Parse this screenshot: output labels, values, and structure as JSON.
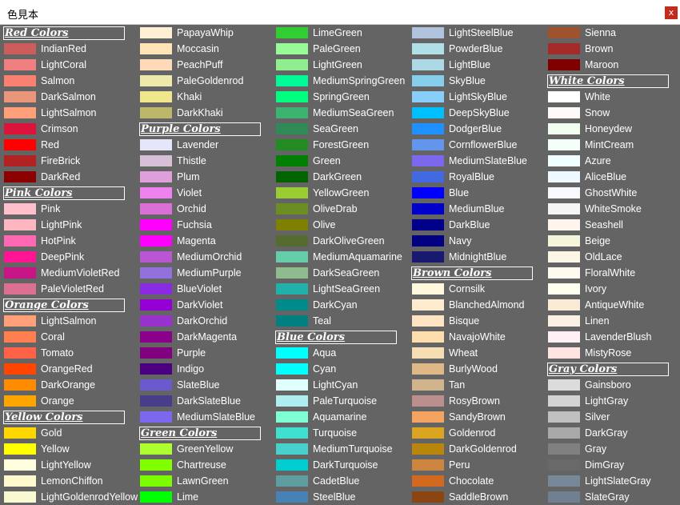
{
  "window": {
    "title": "色見本",
    "close_label": "x"
  },
  "columns": [
    [
      {
        "h": "Red Colors"
      },
      {
        "n": "IndianRed",
        "c": "#CD5C5C"
      },
      {
        "n": "LightCoral",
        "c": "#F08080"
      },
      {
        "n": "Salmon",
        "c": "#FA8072"
      },
      {
        "n": "DarkSalmon",
        "c": "#E9967A"
      },
      {
        "n": "LightSalmon",
        "c": "#FFA07A"
      },
      {
        "n": "Crimson",
        "c": "#DC143C"
      },
      {
        "n": "Red",
        "c": "#FF0000"
      },
      {
        "n": "FireBrick",
        "c": "#B22222"
      },
      {
        "n": "DarkRed",
        "c": "#8B0000"
      },
      {
        "h": "Pink Colors"
      },
      {
        "n": "Pink",
        "c": "#FFC0CB"
      },
      {
        "n": "LightPink",
        "c": "#FFB6C1"
      },
      {
        "n": "HotPink",
        "c": "#FF69B4"
      },
      {
        "n": "DeepPink",
        "c": "#FF1493"
      },
      {
        "n": "MediumVioletRed",
        "c": "#C71585"
      },
      {
        "n": "PaleVioletRed",
        "c": "#DB7093"
      },
      {
        "h": "Orange Colors"
      },
      {
        "n": "LightSalmon",
        "c": "#FFA07A"
      },
      {
        "n": "Coral",
        "c": "#FF7F50"
      },
      {
        "n": "Tomato",
        "c": "#FF6347"
      },
      {
        "n": "OrangeRed",
        "c": "#FF4500"
      },
      {
        "n": "DarkOrange",
        "c": "#FF8C00"
      },
      {
        "n": "Orange",
        "c": "#FFA500"
      },
      {
        "h": "Yellow Colors"
      },
      {
        "n": "Gold",
        "c": "#FFD700"
      },
      {
        "n": "Yellow",
        "c": "#FFFF00"
      },
      {
        "n": "LightYellow",
        "c": "#FFFFE0"
      },
      {
        "n": "LemonChiffon",
        "c": "#FFFACD"
      },
      {
        "n": "LightGoldenrodYellow",
        "c": "#FAFAD2"
      }
    ],
    [
      {
        "n": "PapayaWhip",
        "c": "#FFEFD5"
      },
      {
        "n": "Moccasin",
        "c": "#FFE4B5"
      },
      {
        "n": "PeachPuff",
        "c": "#FFDAB9"
      },
      {
        "n": "PaleGoldenrod",
        "c": "#EEE8AA"
      },
      {
        "n": "Khaki",
        "c": "#F0E68C"
      },
      {
        "n": "DarkKhaki",
        "c": "#BDB76B"
      },
      {
        "h": "Purple Colors"
      },
      {
        "n": "Lavender",
        "c": "#E6E6FA"
      },
      {
        "n": "Thistle",
        "c": "#D8BFD8"
      },
      {
        "n": "Plum",
        "c": "#DDA0DD"
      },
      {
        "n": "Violet",
        "c": "#EE82EE"
      },
      {
        "n": "Orchid",
        "c": "#DA70D6"
      },
      {
        "n": "Fuchsia",
        "c": "#FF00FF"
      },
      {
        "n": "Magenta",
        "c": "#FF00FF"
      },
      {
        "n": "MediumOrchid",
        "c": "#BA55D3"
      },
      {
        "n": "MediumPurple",
        "c": "#9370DB"
      },
      {
        "n": "BlueViolet",
        "c": "#8A2BE2"
      },
      {
        "n": "DarkViolet",
        "c": "#9400D3"
      },
      {
        "n": "DarkOrchid",
        "c": "#9932CC"
      },
      {
        "n": "DarkMagenta",
        "c": "#8B008B"
      },
      {
        "n": "Purple",
        "c": "#800080"
      },
      {
        "n": "Indigo",
        "c": "#4B0082"
      },
      {
        "n": "SlateBlue",
        "c": "#6A5ACD"
      },
      {
        "n": "DarkSlateBlue",
        "c": "#483D8B"
      },
      {
        "n": "MediumSlateBlue",
        "c": "#7B68EE"
      },
      {
        "h": "Green Colors"
      },
      {
        "n": "GreenYellow",
        "c": "#ADFF2F"
      },
      {
        "n": "Chartreuse",
        "c": "#7FFF00"
      },
      {
        "n": "LawnGreen",
        "c": "#7CFC00"
      },
      {
        "n": "Lime",
        "c": "#00FF00"
      }
    ],
    [
      {
        "n": "LimeGreen",
        "c": "#32CD32"
      },
      {
        "n": "PaleGreen",
        "c": "#98FB98"
      },
      {
        "n": "LightGreen",
        "c": "#90EE90"
      },
      {
        "n": "MediumSpringGreen",
        "c": "#00FA9A"
      },
      {
        "n": "SpringGreen",
        "c": "#00FF7F"
      },
      {
        "n": "MediumSeaGreen",
        "c": "#3CB371"
      },
      {
        "n": "SeaGreen",
        "c": "#2E8B57"
      },
      {
        "n": "ForestGreen",
        "c": "#228B22"
      },
      {
        "n": "Green",
        "c": "#008000"
      },
      {
        "n": "DarkGreen",
        "c": "#006400"
      },
      {
        "n": "YellowGreen",
        "c": "#9ACD32"
      },
      {
        "n": "OliveDrab",
        "c": "#6B8E23"
      },
      {
        "n": "Olive",
        "c": "#808000"
      },
      {
        "n": "DarkOliveGreen",
        "c": "#556B2F"
      },
      {
        "n": "MediumAquamarine",
        "c": "#66CDAA"
      },
      {
        "n": "DarkSeaGreen",
        "c": "#8FBC8F"
      },
      {
        "n": "LightSeaGreen",
        "c": "#20B2AA"
      },
      {
        "n": "DarkCyan",
        "c": "#008B8B"
      },
      {
        "n": "Teal",
        "c": "#008080"
      },
      {
        "h": "Blue Colors"
      },
      {
        "n": "Aqua",
        "c": "#00FFFF"
      },
      {
        "n": "Cyan",
        "c": "#00FFFF"
      },
      {
        "n": "LightCyan",
        "c": "#E0FFFF"
      },
      {
        "n": "PaleTurquoise",
        "c": "#AFEEEE"
      },
      {
        "n": "Aquamarine",
        "c": "#7FFFD4"
      },
      {
        "n": "Turquoise",
        "c": "#40E0D0"
      },
      {
        "n": "MediumTurquoise",
        "c": "#48D1CC"
      },
      {
        "n": "DarkTurquoise",
        "c": "#00CED1"
      },
      {
        "n": "CadetBlue",
        "c": "#5F9EA0"
      },
      {
        "n": "SteelBlue",
        "c": "#4682B4"
      }
    ],
    [
      {
        "n": "LightSteelBlue",
        "c": "#B0C4DE"
      },
      {
        "n": "PowderBlue",
        "c": "#B0E0E6"
      },
      {
        "n": "LightBlue",
        "c": "#ADD8E6"
      },
      {
        "n": "SkyBlue",
        "c": "#87CEEB"
      },
      {
        "n": "LightSkyBlue",
        "c": "#87CEFA"
      },
      {
        "n": "DeepSkyBlue",
        "c": "#00BFFF"
      },
      {
        "n": "DodgerBlue",
        "c": "#1E90FF"
      },
      {
        "n": "CornflowerBlue",
        "c": "#6495ED"
      },
      {
        "n": "MediumSlateBlue",
        "c": "#7B68EE"
      },
      {
        "n": "RoyalBlue",
        "c": "#4169E1"
      },
      {
        "n": "Blue",
        "c": "#0000FF"
      },
      {
        "n": "MediumBlue",
        "c": "#0000CD"
      },
      {
        "n": "DarkBlue",
        "c": "#00008B"
      },
      {
        "n": "Navy",
        "c": "#000080"
      },
      {
        "n": "MidnightBlue",
        "c": "#191970"
      },
      {
        "h": "Brown Colors"
      },
      {
        "n": "Cornsilk",
        "c": "#FFF8DC"
      },
      {
        "n": "BlanchedAlmond",
        "c": "#FFEBCD"
      },
      {
        "n": "Bisque",
        "c": "#FFE4C4"
      },
      {
        "n": "NavajoWhite",
        "c": "#FFDEAD"
      },
      {
        "n": "Wheat",
        "c": "#F5DEB3"
      },
      {
        "n": "BurlyWood",
        "c": "#DEB887"
      },
      {
        "n": "Tan",
        "c": "#D2B48C"
      },
      {
        "n": "RosyBrown",
        "c": "#BC8F8F"
      },
      {
        "n": "SandyBrown",
        "c": "#F4A460"
      },
      {
        "n": "Goldenrod",
        "c": "#DAA520"
      },
      {
        "n": "DarkGoldenrod",
        "c": "#B8860B"
      },
      {
        "n": "Peru",
        "c": "#CD853F"
      },
      {
        "n": "Chocolate",
        "c": "#D2691E"
      },
      {
        "n": "SaddleBrown",
        "c": "#8B4513"
      }
    ],
    [
      {
        "n": "Sienna",
        "c": "#A0522D"
      },
      {
        "n": "Brown",
        "c": "#A52A2A"
      },
      {
        "n": "Maroon",
        "c": "#800000"
      },
      {
        "h": "White Colors"
      },
      {
        "n": "White",
        "c": "#FFFFFF"
      },
      {
        "n": "Snow",
        "c": "#FFFAFA"
      },
      {
        "n": "Honeydew",
        "c": "#F0FFF0"
      },
      {
        "n": "MintCream",
        "c": "#F5FFFA"
      },
      {
        "n": "Azure",
        "c": "#F0FFFF"
      },
      {
        "n": "AliceBlue",
        "c": "#F0F8FF"
      },
      {
        "n": "GhostWhite",
        "c": "#F8F8FF"
      },
      {
        "n": "WhiteSmoke",
        "c": "#F5F5F5"
      },
      {
        "n": "Seashell",
        "c": "#FFF5EE"
      },
      {
        "n": "Beige",
        "c": "#F5F5DC"
      },
      {
        "n": "OldLace",
        "c": "#FDF5E6"
      },
      {
        "n": "FloralWhite",
        "c": "#FFFAF0"
      },
      {
        "n": "Ivory",
        "c": "#FFFFF0"
      },
      {
        "n": "AntiqueWhite",
        "c": "#FAEBD7"
      },
      {
        "n": "Linen",
        "c": "#FAF0E6"
      },
      {
        "n": "LavenderBlush",
        "c": "#FFF0F5"
      },
      {
        "n": "MistyRose",
        "c": "#FFE4E1"
      },
      {
        "h": "Gray Colors"
      },
      {
        "n": "Gainsboro",
        "c": "#DCDCDC"
      },
      {
        "n": "LightGray",
        "c": "#D3D3D3"
      },
      {
        "n": "Silver",
        "c": "#C0C0C0"
      },
      {
        "n": "DarkGray",
        "c": "#A9A9A9"
      },
      {
        "n": "Gray",
        "c": "#808080"
      },
      {
        "n": "DimGray",
        "c": "#696969"
      },
      {
        "n": "LightSlateGray",
        "c": "#778899"
      },
      {
        "n": "SlateGray",
        "c": "#708090"
      }
    ]
  ]
}
